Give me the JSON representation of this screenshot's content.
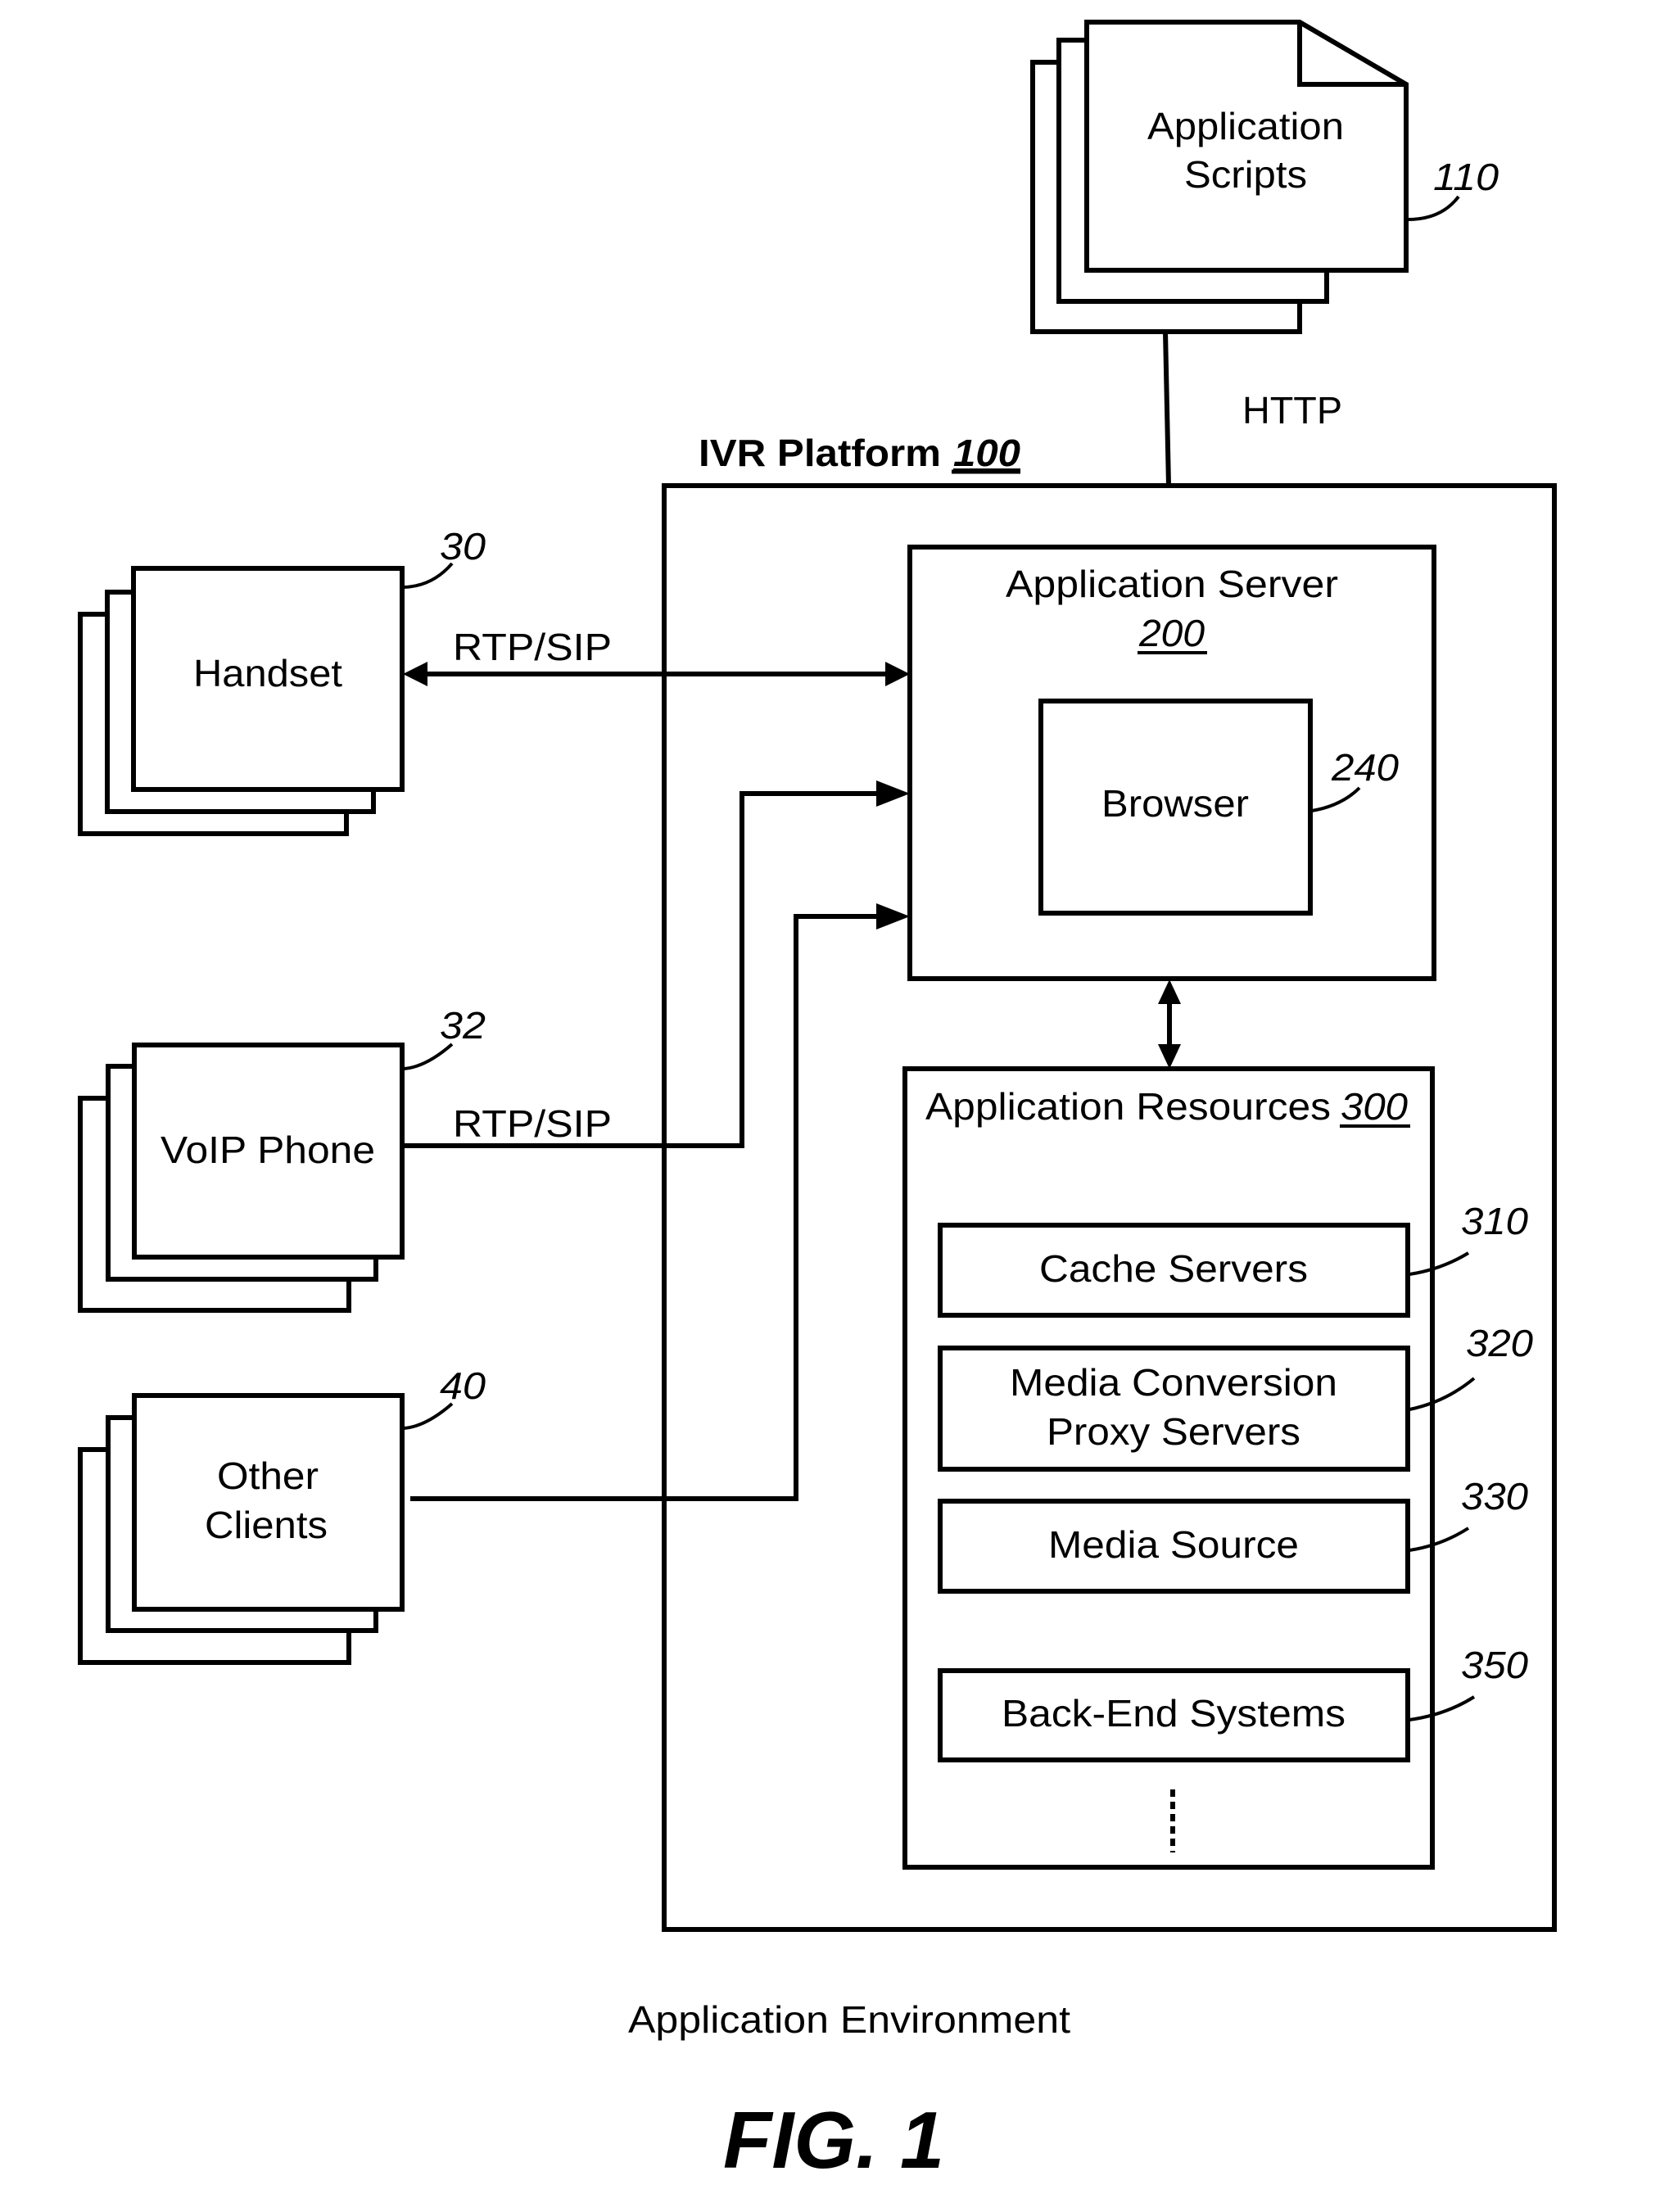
{
  "figure": {
    "caption": "Application Environment",
    "figure_label": "FIG. 1"
  },
  "application_scripts": {
    "line1": "Application",
    "line2": "Scripts",
    "ref": "110",
    "connection_label": "HTTP"
  },
  "ivr_platform": {
    "title": "IVR Platform",
    "ref": "100"
  },
  "application_server": {
    "title": "Application Server",
    "ref": "200",
    "browser": {
      "label": "Browser",
      "ref": "240"
    }
  },
  "application_resources": {
    "title": "Application Resources",
    "ref": "300",
    "items": [
      {
        "lines": [
          "Cache Servers"
        ],
        "ref": "310"
      },
      {
        "lines": [
          "Media Conversion",
          "Proxy Servers"
        ],
        "ref": "320"
      },
      {
        "lines": [
          "Media Source"
        ],
        "ref": "330"
      },
      {
        "lines": [
          "Back-End Systems"
        ],
        "ref": "350"
      }
    ]
  },
  "clients": [
    {
      "lines": [
        "Handset"
      ],
      "ref": "30",
      "connection_label": "RTP/SIP"
    },
    {
      "lines": [
        "VoIP Phone"
      ],
      "ref": "32",
      "connection_label": "RTP/SIP"
    },
    {
      "lines": [
        "Other",
        "Clients"
      ],
      "ref": "40",
      "connection_label": ""
    }
  ]
}
